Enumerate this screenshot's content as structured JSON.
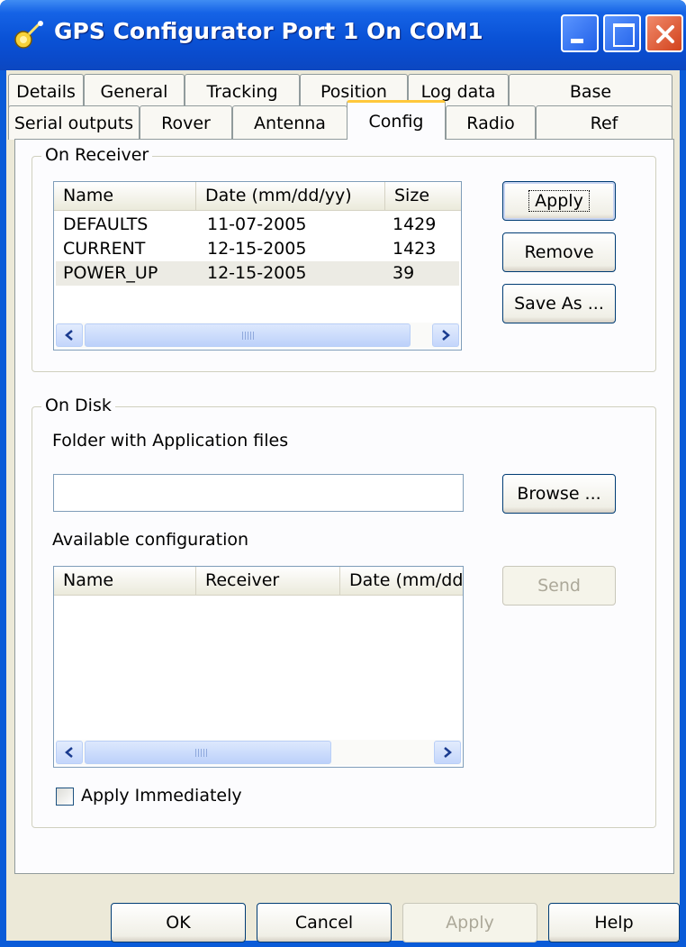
{
  "window": {
    "title": "GPS Configurator Port 1 On COM1"
  },
  "tabs": {
    "row1": [
      "Details",
      "General",
      "Tracking",
      "Position",
      "Log data",
      "Base"
    ],
    "row2": [
      "Serial outputs",
      "Rover",
      "Antenna",
      "Config",
      "Radio",
      "Ref"
    ],
    "active": "Config"
  },
  "on_receiver": {
    "group_label": "On Receiver",
    "columns": [
      "Name",
      "Date (mm/dd/yy)",
      "Size"
    ],
    "rows": [
      {
        "name": "DEFAULTS",
        "date": "11-07-2005",
        "size": "1429"
      },
      {
        "name": "CURRENT",
        "date": "12-15-2005",
        "size": "1423"
      },
      {
        "name": "POWER_UP",
        "date": "12-15-2005",
        "size": "39"
      }
    ],
    "selected_row": 2,
    "apply_label": "Apply",
    "remove_label": "Remove",
    "save_as_label": "Save As ..."
  },
  "on_disk": {
    "group_label": "On Disk",
    "folder_label": "Folder with Application files",
    "folder_value": "",
    "browse_label": "Browse ...",
    "available_label": "Available configuration",
    "columns": [
      "Name",
      "Receiver",
      "Date (mm/dd/yy)"
    ],
    "send_label": "Send",
    "apply_immediately_label": "Apply Immediately",
    "apply_immediately_checked": false
  },
  "footer": {
    "ok_label": "OK",
    "cancel_label": "Cancel",
    "apply_label": "Apply",
    "help_label": "Help"
  },
  "colors": {
    "titlebar": "#0a52d6",
    "dialog_bg": "#ece9d8",
    "active_tab_accent": "#ffc83c",
    "close_button": "#d2421c"
  }
}
